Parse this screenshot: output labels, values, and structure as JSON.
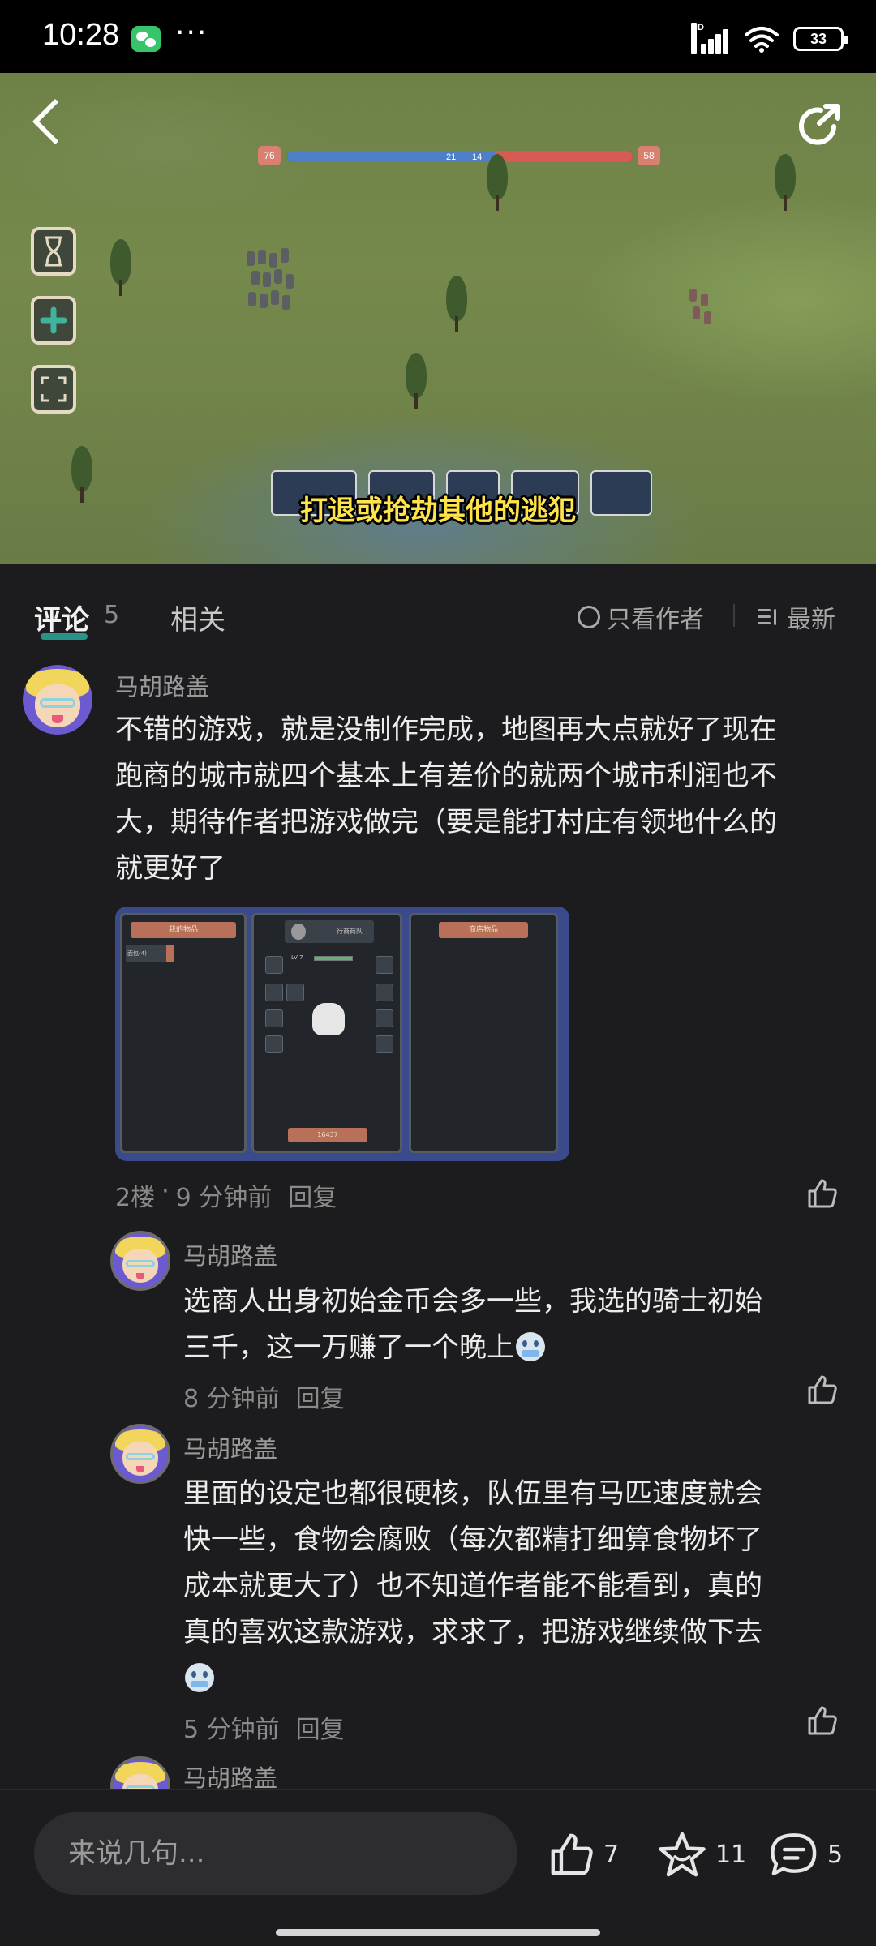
{
  "status_bar": {
    "time": "10:28",
    "dots": "···",
    "network": "HD",
    "battery": "33"
  },
  "video": {
    "subtitle": "打退或抢劫其他的逃犯",
    "hud": {
      "left_cap": "76",
      "left_count": "21",
      "right_count": "14",
      "right_cap": "58"
    },
    "health_bar": {
      "player_fraction": 0.6,
      "enemy_fraction": 0.4
    },
    "buttons": [
      "back-icon",
      "share-icon",
      "hourglass-icon",
      "plus-icon",
      "fullscreen-icon"
    ]
  },
  "tabs": {
    "comments_label": "评论",
    "comments_count": "5",
    "related_label": "相关",
    "author_only_label": "只看作者",
    "latest_label": "最新"
  },
  "comments": [
    {
      "user": "马胡路盖",
      "lines": [
        "不错的游戏，就是没制作完成，地图再大点就好了现在",
        "跑商的城市就四个基本上有差价的就两个城市利润也不",
        "大，期待作者把游戏做完（要是能打村庄有领地什么的",
        "就更好了"
      ],
      "attachment": {
        "panel_left_title": "我的物品",
        "panel_left_item": "面包(4)",
        "panel_mid_title": "行商商队",
        "panel_mid_level": "LV 7",
        "panel_mid_coins": "16437",
        "panel_right_title": "商店物品"
      },
      "floor": "2楼",
      "sep": "·",
      "time": "9 分钟前",
      "reply": "回复"
    },
    {
      "user": "马胡路盖",
      "lines": [
        "选商人出身初始金币会多一些，我选的骑士初始",
        "三千，这一万赚了一个晚上"
      ],
      "time": "8 分钟前",
      "reply": "回复"
    },
    {
      "user": "马胡路盖",
      "lines": [
        "里面的设定也都很硬核，队伍里有马匹速度就会",
        "快一些，食物会腐败（每次都精打细算食物坏了",
        "成本就更大了）也不知道作者能不能看到，真的",
        "真的喜欢这款游戏，求求了，把游戏继续做下去"
      ],
      "time": "5 分钟前",
      "reply": "回复"
    },
    {
      "user": "马胡路盖"
    }
  ],
  "bottom_bar": {
    "input_placeholder": "来说几句...",
    "likes": "7",
    "favorites": "11",
    "comments": "5"
  },
  "colors": {
    "accent": "#2aa89a",
    "background": "#1c1c1e",
    "subtitle": "#ffe34a"
  }
}
